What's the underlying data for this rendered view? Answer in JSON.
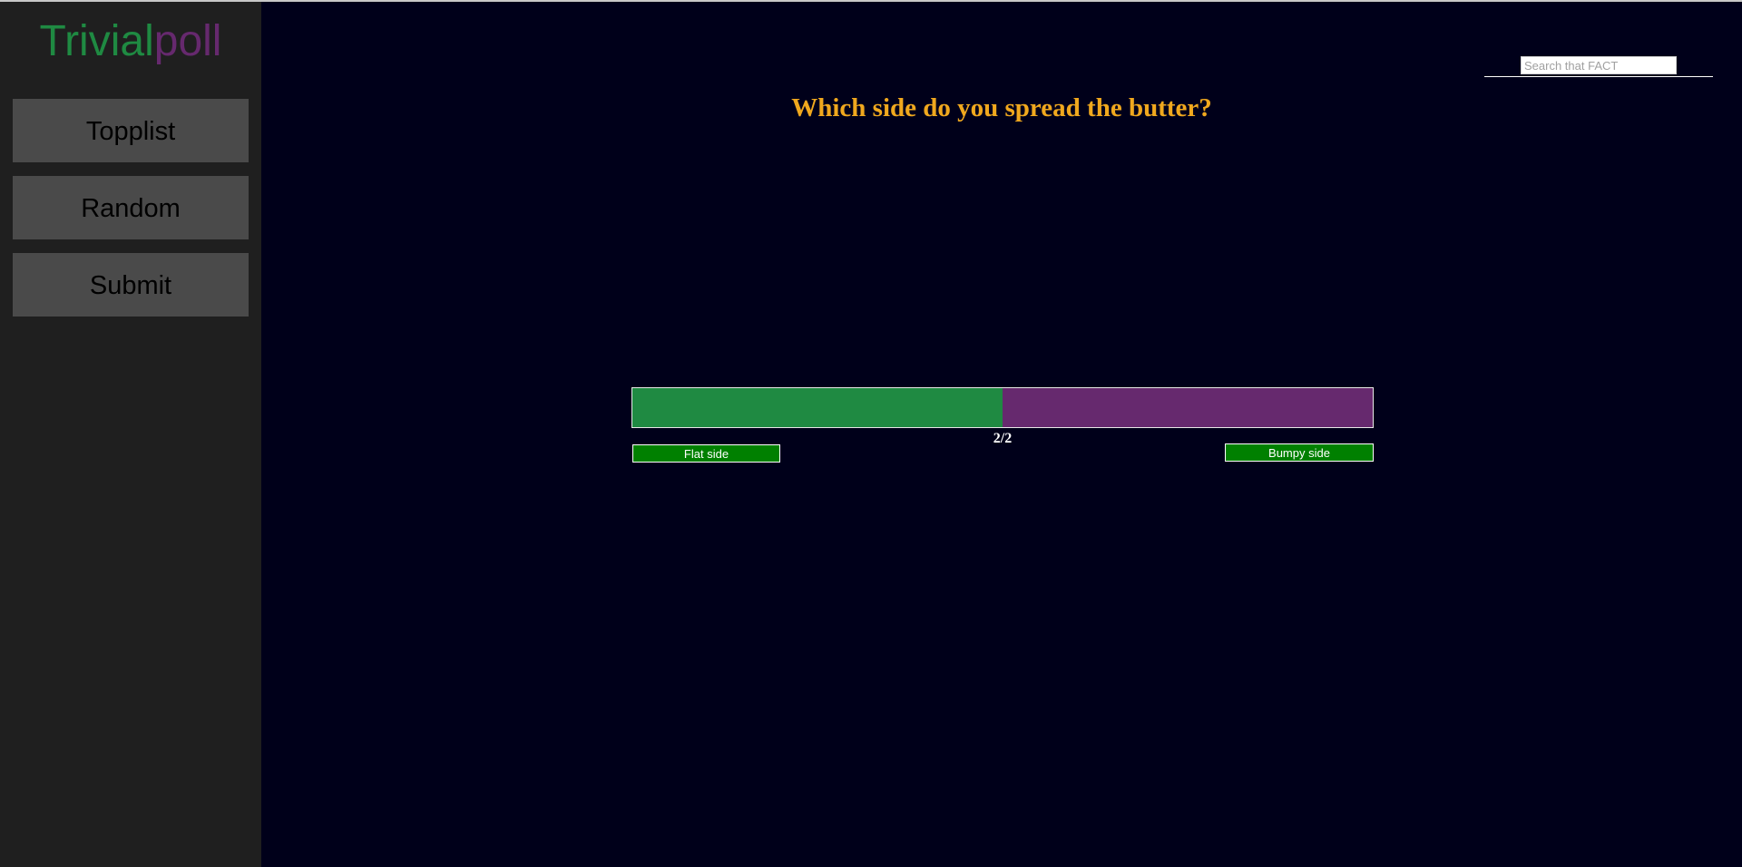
{
  "logo": {
    "part_a": "Trivial",
    "part_b": "poll"
  },
  "nav": {
    "topplist": "Topplist",
    "random": "Random",
    "submit": "Submit"
  },
  "search": {
    "placeholder": "Search that FACT",
    "value": ""
  },
  "poll": {
    "question": "Which side do you spread the butter?",
    "vote_count": "2/2",
    "answer_a": "Flat side",
    "answer_b": "Bumpy side",
    "share_a_percent": 50,
    "share_b_percent": 50
  },
  "colors": {
    "background": "#00001a",
    "sidebar": "#1f1f1f",
    "nav_button": "#4a4a4a",
    "accent_green": "#1f8a42",
    "accent_purple": "#66296e",
    "question": "#f0a81e",
    "answer_button": "#008000"
  }
}
